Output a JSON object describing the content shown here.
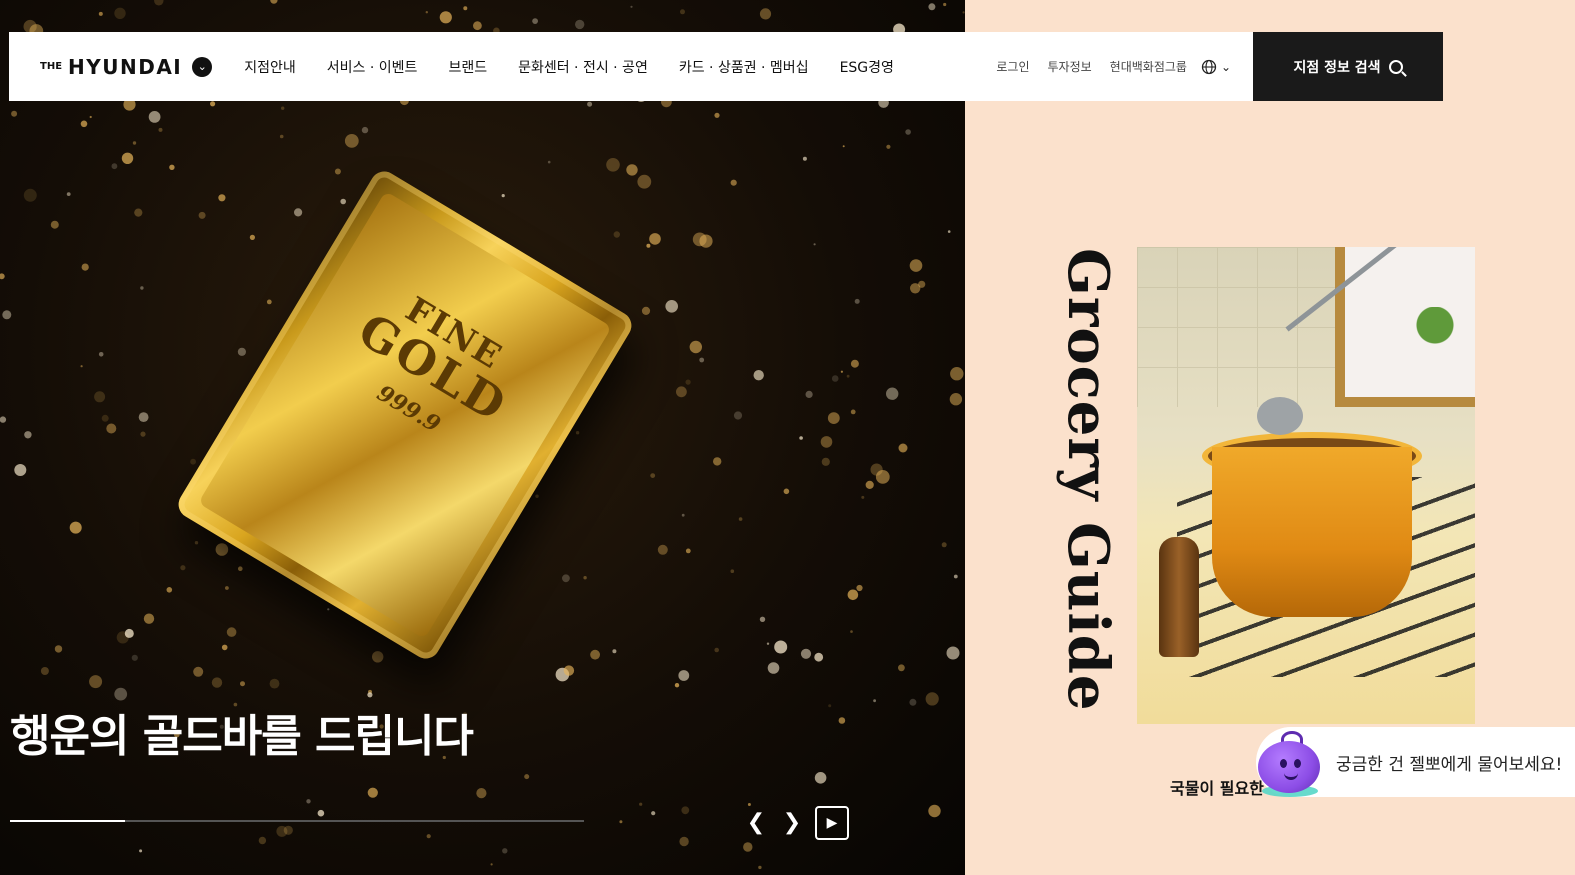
{
  "header": {
    "logo_prefix": "THE",
    "logo_name": "HYUNDAI",
    "nav": [
      "지점안내",
      "서비스 · 이벤트",
      "브랜드",
      "문화센터 · 전시 · 공연",
      "카드 · 상품권 · 멤버십",
      "ESG경영"
    ],
    "util": [
      "로그인",
      "투자정보",
      "현대백화점그룹"
    ],
    "search_label": "지점 정보 검색"
  },
  "hero": {
    "bar_text": [
      "FINE",
      "GOLD",
      "999.9"
    ],
    "title": "행운의 골드바를 드립니다",
    "progress": 0.2
  },
  "side": {
    "title": "Grocery Guide",
    "caption": "국물이 필요한"
  },
  "chat": {
    "text": "궁금한 건 젤뽀에게 물어보세요!"
  },
  "colors": {
    "panel_bg": "#fbe1cc",
    "search_bg": "#1a1a1a",
    "mascot": "#8c4de6"
  }
}
